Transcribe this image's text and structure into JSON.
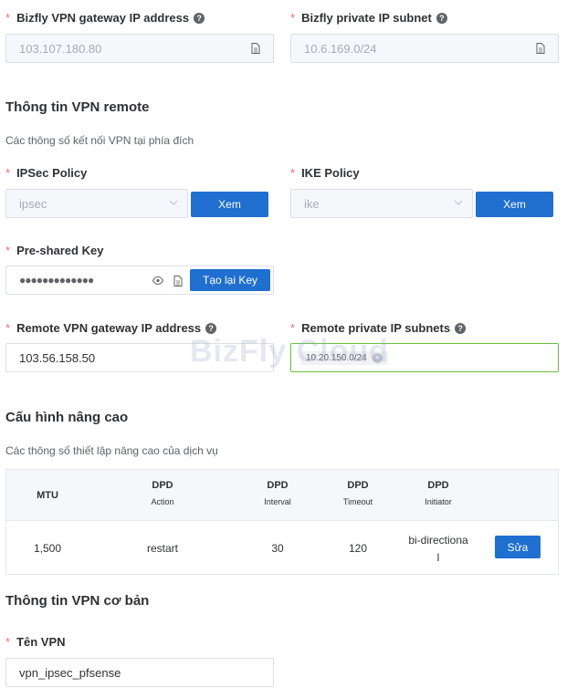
{
  "gateway": {
    "label": "Bizfly VPN gateway IP address",
    "value": "103.107.180.80"
  },
  "private_subnet": {
    "label": "Bizfly private IP subnet",
    "value": "10.6.169.0/24"
  },
  "remote_section": {
    "title": "Thông tin VPN remote",
    "desc": "Các thông số kết nối VPN tại phía đích"
  },
  "ipsec": {
    "label": "IPSec Policy",
    "value": "ipsec",
    "button": "Xem"
  },
  "ike": {
    "label": "IKE Policy",
    "value": "ike",
    "button": "Xem"
  },
  "psk": {
    "label": "Pre-shared Key",
    "value": "●●●●●●●●●●●●●",
    "regen_button": "Tạo lại Key"
  },
  "remote_gateway": {
    "label": "Remote VPN gateway IP address",
    "value": "103.56.158.50"
  },
  "remote_subnets": {
    "label": "Remote private IP subnets",
    "tags": [
      "10.20.150.0/24"
    ]
  },
  "watermark": "BizFly Cloud",
  "advanced_section": {
    "title": "Cấu hình nâng cao",
    "desc": "Các thông số thiết lập nâng cao của dịch vụ"
  },
  "table": {
    "headers": [
      {
        "main": "MTU",
        "sub": ""
      },
      {
        "main": "DPD",
        "sub": "Action"
      },
      {
        "main": "DPD",
        "sub": "Interval"
      },
      {
        "main": "DPD",
        "sub": "Timeout"
      },
      {
        "main": "DPD",
        "sub": "Initiator"
      }
    ],
    "row": {
      "mtu": "1,500",
      "action": "restart",
      "interval": "30",
      "timeout": "120",
      "initiator_line1": "bi-directiona",
      "initiator_line2": "l",
      "edit_button": "Sửa"
    }
  },
  "basic_section": {
    "title": "Thông tin VPN cơ bản"
  },
  "vpn_name": {
    "label": "Tên VPN",
    "value": "vpn_ipsec_pfsense"
  }
}
